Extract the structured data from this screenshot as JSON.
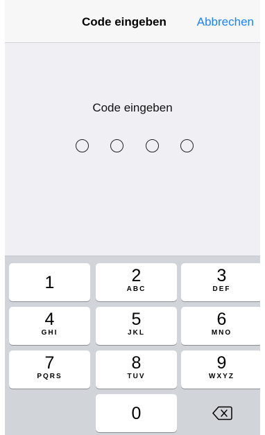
{
  "navbar": {
    "title": "Code eingeben",
    "cancel_label": "Abbrechen"
  },
  "prompt": "Code eingeben",
  "passcode": {
    "length": 4,
    "filled": 0
  },
  "keypad": {
    "keys": [
      {
        "digit": "1",
        "letters": ""
      },
      {
        "digit": "2",
        "letters": "ABC"
      },
      {
        "digit": "3",
        "letters": "DEF"
      },
      {
        "digit": "4",
        "letters": "GHI"
      },
      {
        "digit": "5",
        "letters": "JKL"
      },
      {
        "digit": "6",
        "letters": "MNO"
      },
      {
        "digit": "7",
        "letters": "PQRS"
      },
      {
        "digit": "8",
        "letters": "TUV"
      },
      {
        "digit": "9",
        "letters": "WXYZ"
      },
      {
        "digit": "0",
        "letters": ""
      }
    ],
    "delete_icon": "backspace-icon"
  },
  "colors": {
    "accent": "#1a82fb",
    "background": "#efeff4",
    "keypad_background": "#d1d4d9"
  }
}
